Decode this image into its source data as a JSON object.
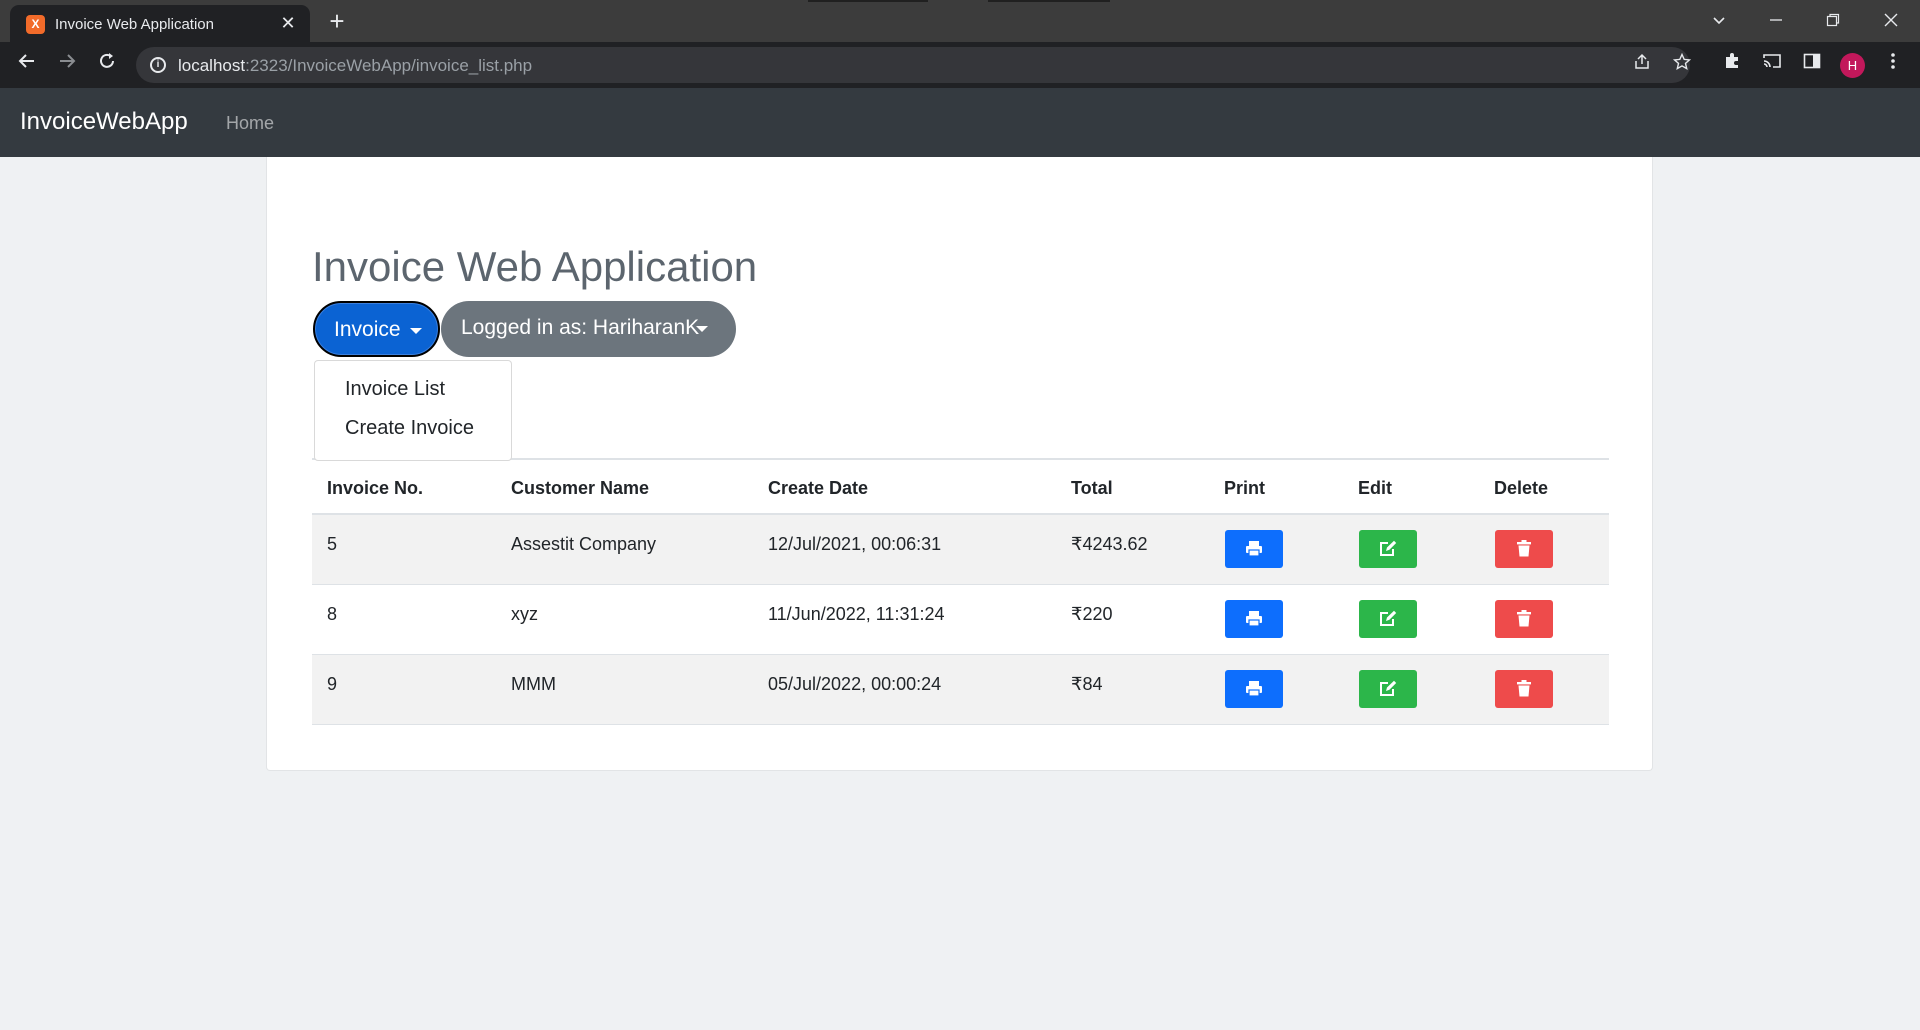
{
  "browser": {
    "tab_title": "Invoice Web Application",
    "tab_close": "✕",
    "new_tab": "+",
    "url_host": "localhost",
    "url_rest": ":2323/InvoiceWebApp/invoice_list.php",
    "avatar_initial": "H",
    "colors": {
      "titlebar": "#3c3c3c",
      "toolbar": "#202124",
      "avatar": "#c2185b"
    }
  },
  "navbar": {
    "brand": "InvoiceWebApp",
    "home": "Home"
  },
  "main": {
    "title": "Invoice Web Application",
    "invoice_button": "Invoice",
    "user_button": "Logged in as: HariharanK",
    "dropdown": {
      "items": [
        {
          "label": "Invoice List"
        },
        {
          "label": "Create Invoice"
        }
      ]
    }
  },
  "table": {
    "headers": [
      "Invoice No.",
      "Customer Name",
      "Create Date",
      "Total",
      "Print",
      "Edit",
      "Delete"
    ],
    "rows": [
      {
        "invoice_no": "5",
        "customer": "Assestit Company",
        "date": "12/Jul/2021, 00:06:31",
        "total": "₹4243.62"
      },
      {
        "invoice_no": "8",
        "customer": "xyz",
        "date": "11/Jun/2022, 11:31:24",
        "total": "₹220"
      },
      {
        "invoice_no": "9",
        "customer": "MMM",
        "date": "05/Jul/2022, 00:00:24",
        "total": "₹84"
      }
    ],
    "action_icons": {
      "print": "print-icon",
      "edit": "edit-icon",
      "delete": "trash-icon"
    },
    "colors": {
      "print": "#0d6efd",
      "edit": "#2cb64a",
      "delete": "#ee4b4b"
    }
  }
}
